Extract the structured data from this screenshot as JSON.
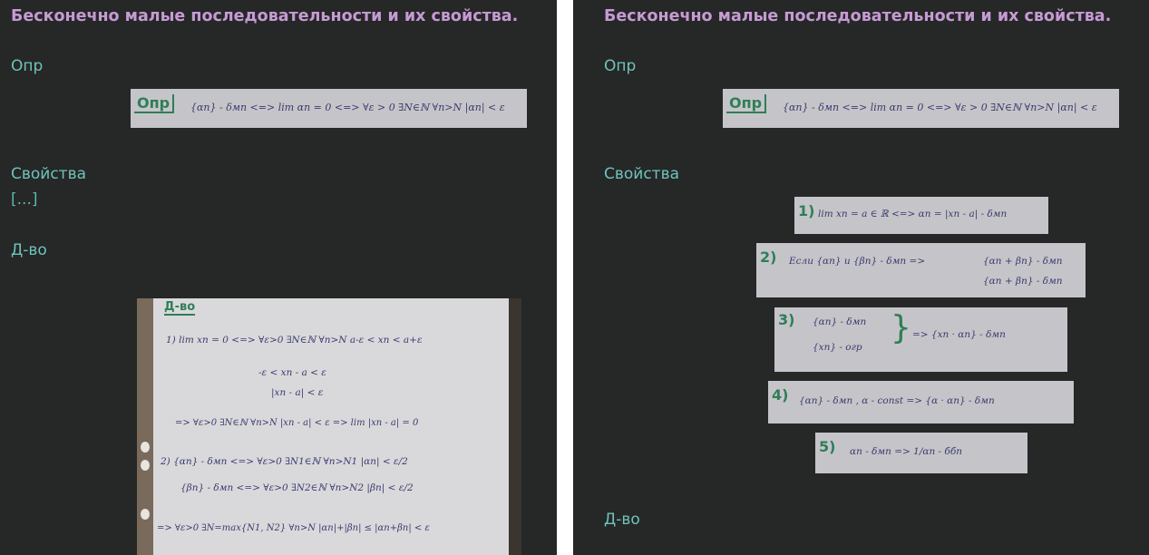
{
  "colors": {
    "background": "#262727",
    "title": "#c69ad4",
    "heading": "#6fc3bb",
    "ink_green": "#2f7e58",
    "ink_blue": "#3a3a6e"
  },
  "left": {
    "title": "Бесконечно малые последовательности и их свойства.",
    "def_heading": "Опр",
    "def_image": {
      "tag": "Опр",
      "text": "{αn} - δмп <=> lim αn = 0 <=> ∀ε > 0 ∃N∈ℕ ∀n>N |αn| < ε"
    },
    "props_heading": "Свойства",
    "collapsed": "[...]",
    "proof_heading": "Д-во",
    "proof_photo": {
      "tag": "Д-во",
      "lines": [
        "1) lim xn = 0 <=> ∀ε>0 ∃N∈ℕ ∀n>N a-ε < xn < a+ε",
        "-ε < xn - a < ε",
        "|xn - a| < ε",
        "=> ∀ε>0 ∃N∈ℕ ∀n>N |xn - a| < ε => lim |xn - a| = 0",
        "2) {αn} - δмп <=> ∀ε>0 ∃N1∈ℕ ∀n>N1 |αn| < ε/2",
        "{βn} - δмп <=> ∀ε>0 ∃N2∈ℕ ∀n>N2 |βn| < ε/2",
        "=> ∀ε>0 ∃N=max{N1, N2} ∀n>N |αn|+|βn| ≤ |αn+βn| < ε"
      ]
    }
  },
  "right": {
    "title": "Бесконечно малые последовательности и их свойства.",
    "def_heading": "Опр",
    "def_image": {
      "tag": "Опр",
      "text": "{αn} - δмп <=> lim αn = 0 <=> ∀ε > 0 ∃N∈ℕ ∀n>N |αn| < ε"
    },
    "props_heading": "Свойства",
    "properties": [
      {
        "tag": "1)",
        "text": "lim xn = a ∈ ℝ <=> αn = |xn - a| - δмп"
      },
      {
        "tag": "2)",
        "text": "Если {αn} и {βn} - δмп =>",
        "text2": "{αn + βn} - δмп",
        "text3": "{αn + βn} - δмп"
      },
      {
        "tag": "3)",
        "text": "{αn} - δмп",
        "text2": "{xn} - огр",
        "text3": "=> {xn · αn} - δмп"
      },
      {
        "tag": "4)",
        "text": "{αn} - δмп , α - const => {α · αn} - δмп"
      },
      {
        "tag": "5)",
        "text": "αn - δмп => 1/αn - ббп"
      }
    ],
    "proof_heading": "Д-во"
  }
}
